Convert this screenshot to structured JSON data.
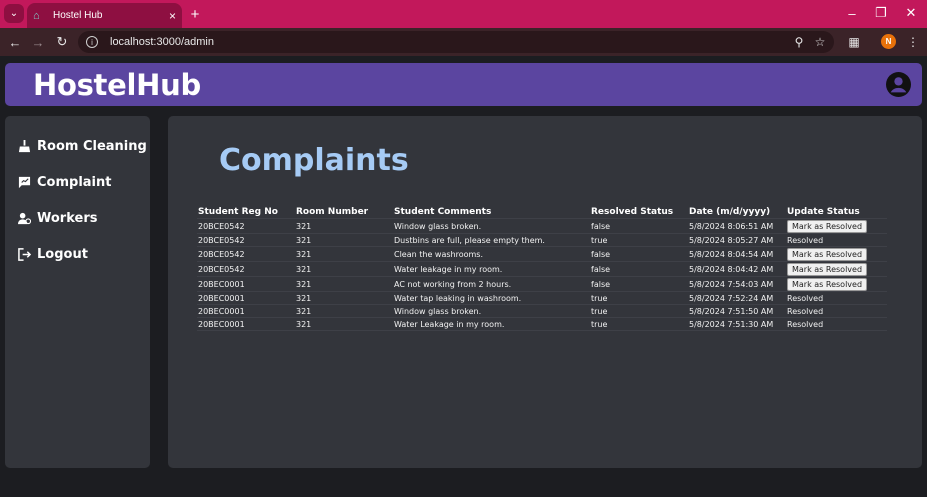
{
  "browser": {
    "tab_title": "Hostel Hub",
    "url": "localhost:3000/admin",
    "profile_initial": "N"
  },
  "app": {
    "brand": "HostelHub",
    "page_title": "Complaints"
  },
  "sidebar": {
    "items": [
      {
        "label": "Room Cleaning",
        "icon": "broom-icon"
      },
      {
        "label": "Complaint",
        "icon": "message-icon"
      },
      {
        "label": "Workers",
        "icon": "workers-icon"
      },
      {
        "label": "Logout",
        "icon": "logout-icon"
      }
    ]
  },
  "table": {
    "headers": [
      "Student Reg No",
      "Room Number",
      "Student Comments",
      "Resolved Status",
      "Date (m/d/yyyy)",
      "Update Status"
    ],
    "button_label": "Mark as Resolved",
    "rows": [
      {
        "reg": "20BCE0542",
        "room": "321",
        "comment": "Window glass broken.",
        "status": "false",
        "date": "5/8/2024 8:06:51 AM",
        "update": "Mark as Resolved",
        "resolved": false
      },
      {
        "reg": "20BCE0542",
        "room": "321",
        "comment": "Dustbins are full, please empty them.",
        "status": "true",
        "date": "5/8/2024 8:05:27 AM",
        "update": "Resolved",
        "resolved": true
      },
      {
        "reg": "20BCE0542",
        "room": "321",
        "comment": "Clean the washrooms.",
        "status": "false",
        "date": "5/8/2024 8:04:54 AM",
        "update": "Mark as Resolved",
        "resolved": false
      },
      {
        "reg": "20BCE0542",
        "room": "321",
        "comment": "Water leakage in my room.",
        "status": "false",
        "date": "5/8/2024 8:04:42 AM",
        "update": "Mark as Resolved",
        "resolved": false
      },
      {
        "reg": "20BEC0001",
        "room": "321",
        "comment": "AC not working from 2 hours.",
        "status": "false",
        "date": "5/8/2024 7:54:03 AM",
        "update": "Mark as Resolved",
        "resolved": false
      },
      {
        "reg": "20BEC0001",
        "room": "321",
        "comment": "Water tap leaking in washroom.",
        "status": "true",
        "date": "5/8/2024 7:52:24 AM",
        "update": "Resolved",
        "resolved": true
      },
      {
        "reg": "20BEC0001",
        "room": "321",
        "comment": "Window glass broken.",
        "status": "true",
        "date": "5/8/2024 7:51:50 AM",
        "update": "Resolved",
        "resolved": true
      },
      {
        "reg": "20BEC0001",
        "room": "321",
        "comment": "Water Leakage in my room.",
        "status": "true",
        "date": "5/8/2024 7:51:30 AM",
        "update": "Resolved",
        "resolved": true
      }
    ]
  },
  "colors": {
    "tabstrip": "#c2185b",
    "header": "#5b45a0",
    "panel": "#33353b",
    "title": "#a6cbf5"
  }
}
